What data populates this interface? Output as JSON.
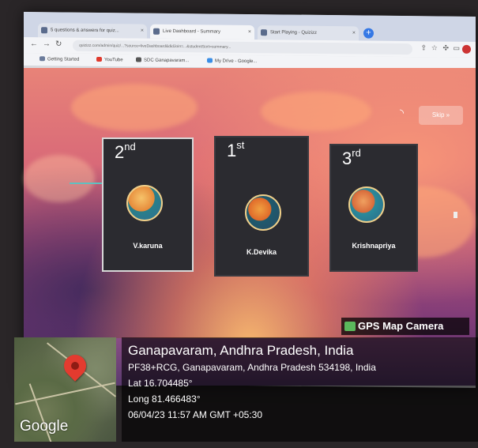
{
  "browser": {
    "tabs": [
      {
        "label": "5 questions & answers for quiz..."
      },
      {
        "label": "Live Dashboard - Summary"
      },
      {
        "label": "Start Playing - Quizizz"
      }
    ],
    "url": "quizizz.com/admin/quiz/...?source=liveDashboard&didJoin=...&studentSort=summary...",
    "bookmarks": [
      {
        "label": "Getting Started"
      },
      {
        "label": "YouTube"
      },
      {
        "label": "SDC Ganapavaram..."
      },
      {
        "label": "My Drive - Google..."
      }
    ]
  },
  "quiz": {
    "skip_label": "Skip »",
    "podium": [
      {
        "rank_num": "2",
        "rank_suffix": "nd",
        "name": "V.karuna"
      },
      {
        "rank_num": "1",
        "rank_suffix": "st",
        "name": "K.Devika"
      },
      {
        "rank_num": "3",
        "rank_suffix": "rd",
        "name": "Krishnapriya"
      }
    ]
  },
  "gps": {
    "app_label": "GPS Map Camera",
    "map_brand": "Google",
    "place": "Ganapavaram, Andhra Pradesh, India",
    "address": "PF38+RCG, Ganapavaram, Andhra Pradesh 534198, India",
    "lat": "Lat 16.704485°",
    "long": "Long 81.466483°",
    "timestamp": "06/04/23 11:57 AM GMT +05:30"
  },
  "colors": {
    "pin": "#e33b2f",
    "new_tab": "#3578e5"
  }
}
